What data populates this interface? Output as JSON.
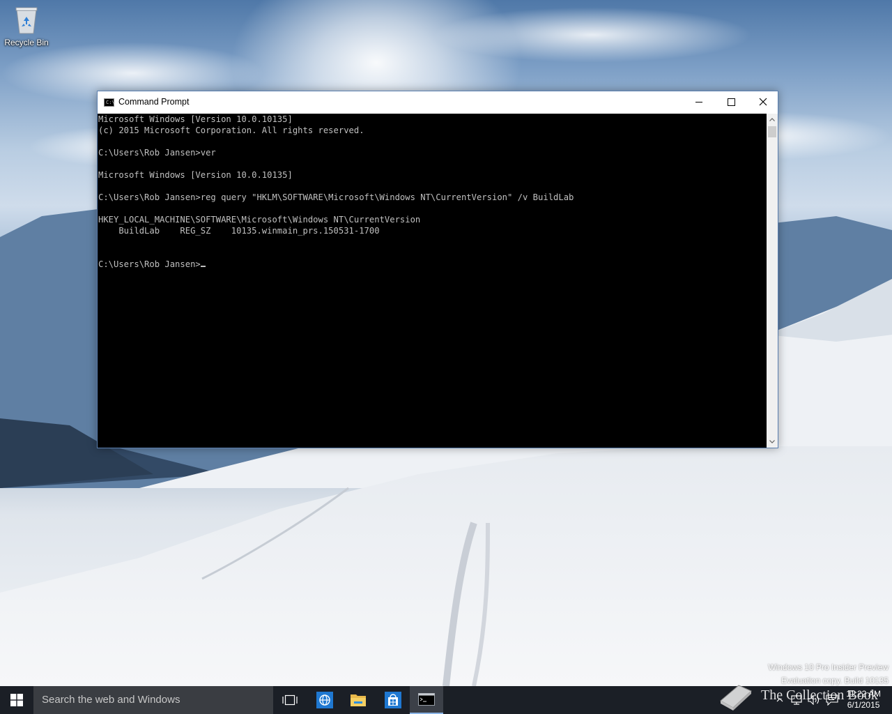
{
  "desktop": {
    "icons": [
      {
        "label": "Recycle Bin",
        "icon": "recycle-bin-icon"
      }
    ],
    "watermark": {
      "line1": "Windows 10 Pro Insider Preview",
      "line2": "Evaluation copy. Build 10135"
    },
    "brand_overlay": "The Collection Book"
  },
  "window": {
    "title": "Command Prompt",
    "icon": "cmd-icon",
    "controls": {
      "minimize": "minimize-icon",
      "maximize": "maximize-icon",
      "close": "close-icon"
    },
    "console_lines": [
      "Microsoft Windows [Version 10.0.10135]",
      "(c) 2015 Microsoft Corporation. All rights reserved.",
      "",
      "C:\\Users\\Rob Jansen>ver",
      "",
      "Microsoft Windows [Version 10.0.10135]",
      "",
      "C:\\Users\\Rob Jansen>reg query \"HKLM\\SOFTWARE\\Microsoft\\Windows NT\\CurrentVersion\" /v BuildLab",
      "",
      "HKEY_LOCAL_MACHINE\\SOFTWARE\\Microsoft\\Windows NT\\CurrentVersion",
      "    BuildLab    REG_SZ    10135.winmain_prs.150531-1700",
      "",
      ""
    ],
    "prompt": "C:\\Users\\Rob Jansen>",
    "colors": {
      "console_bg": "#000000",
      "console_fg": "#c0c0c0"
    }
  },
  "taskbar": {
    "search_placeholder": "Search the web and Windows",
    "pinned": [
      {
        "name": "task-view",
        "icon": "task-view-icon"
      },
      {
        "name": "browser",
        "icon": "globe-icon"
      },
      {
        "name": "file-explorer",
        "icon": "folder-icon"
      },
      {
        "name": "store",
        "icon": "store-icon"
      },
      {
        "name": "command-prompt",
        "icon": "cmd-icon",
        "active": true
      }
    ],
    "tray_icons": [
      "chevron-up-icon",
      "network-icon",
      "volume-icon",
      "action-center-icon"
    ],
    "clock": {
      "time": "11:22 AM",
      "date": "6/1/2015"
    },
    "colors": {
      "taskbar_bg": "#1b1f26",
      "search_bg": "#3a3d42",
      "active_indicator": "#8ab4e6"
    }
  }
}
